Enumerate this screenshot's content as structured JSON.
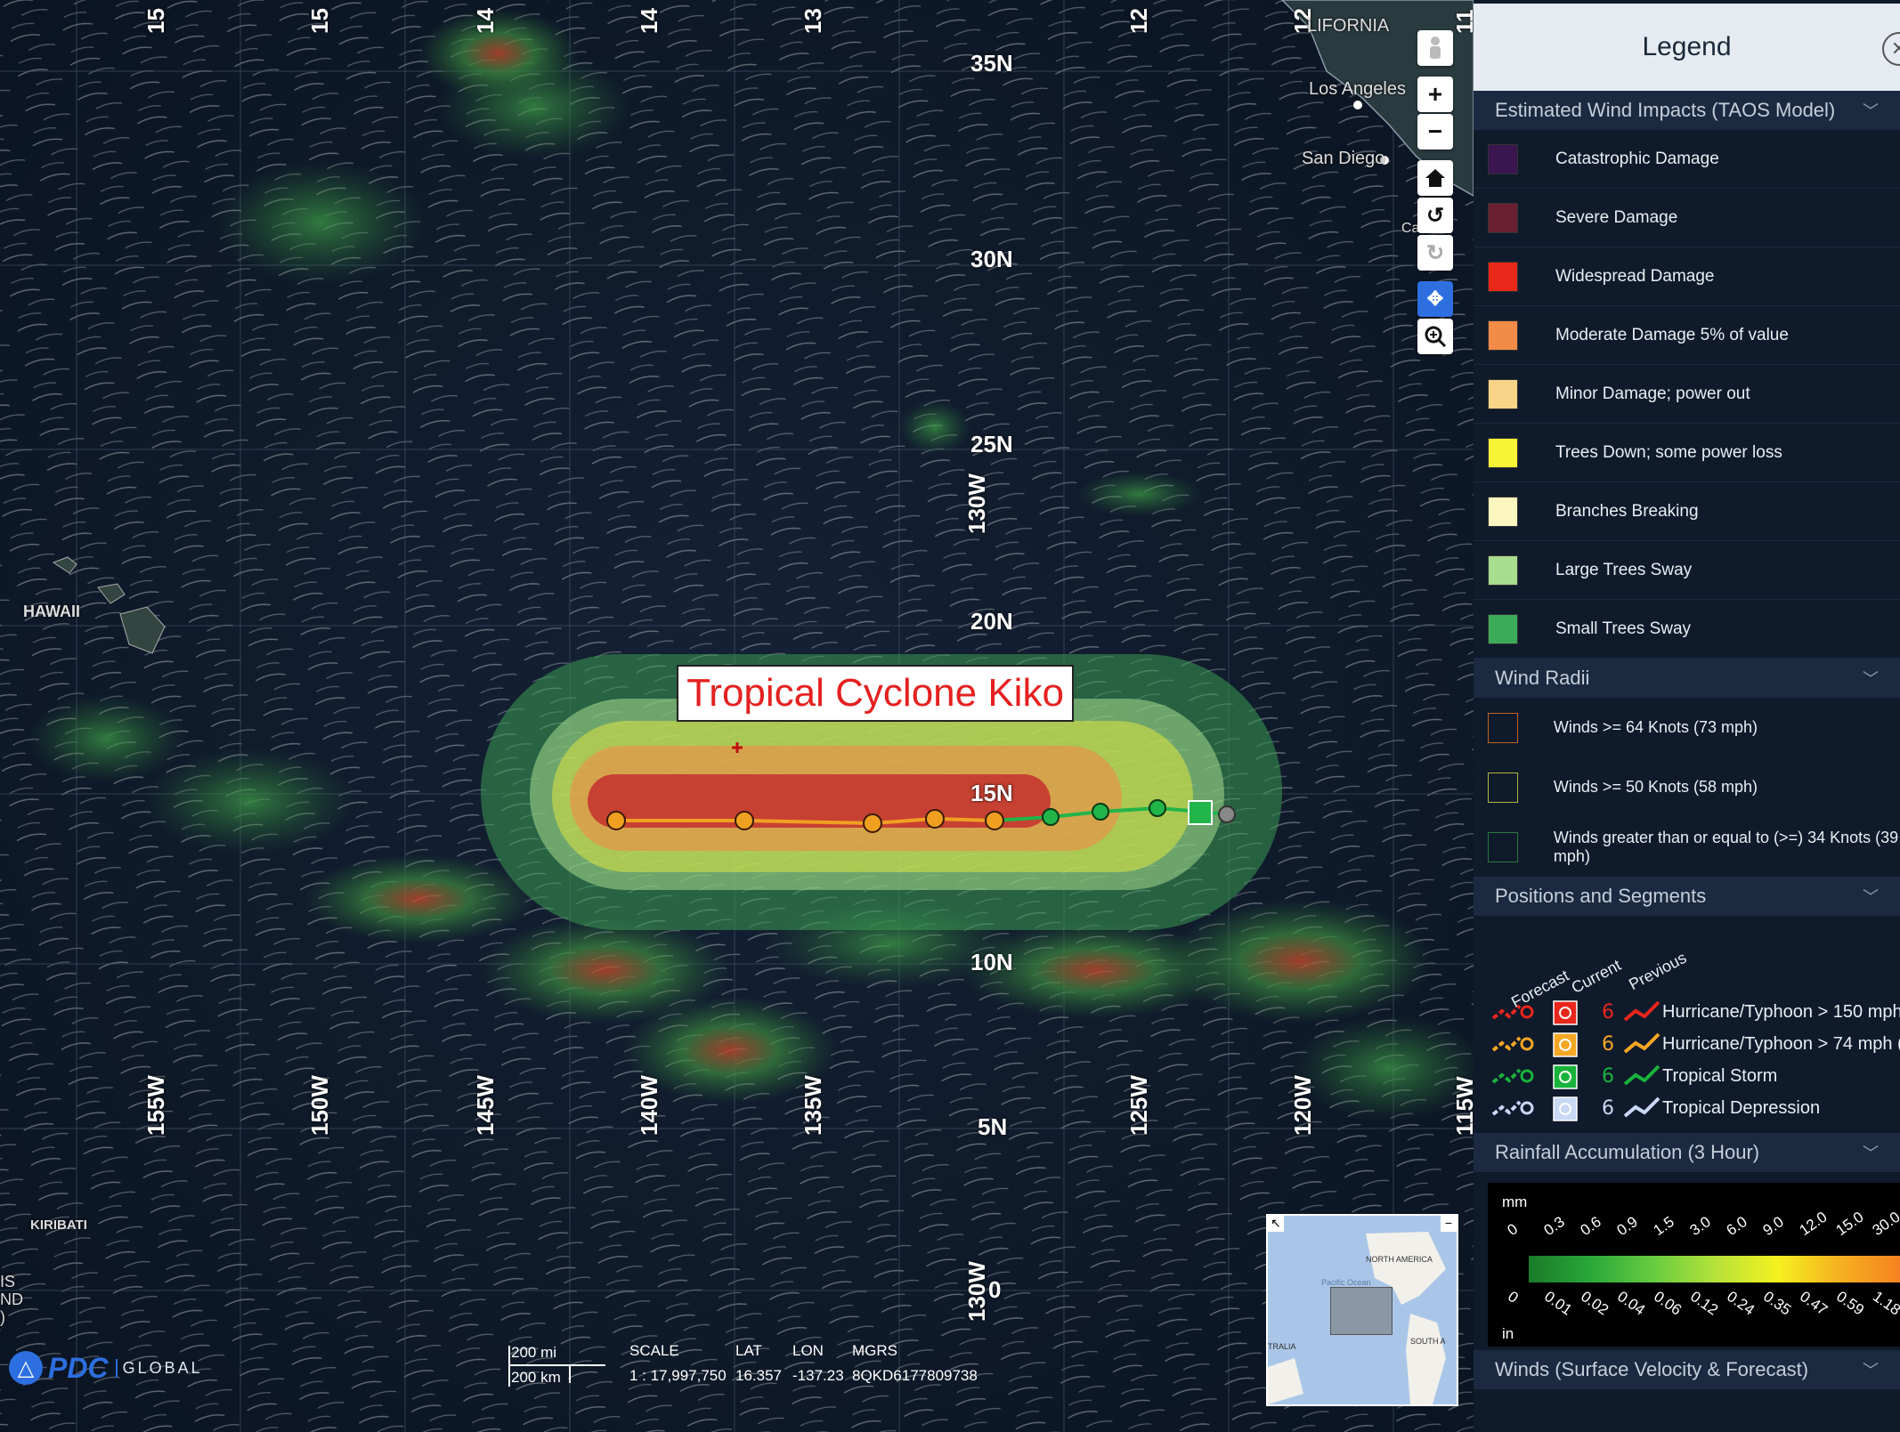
{
  "map": {
    "lat_labels": [
      "35N",
      "30N",
      "25N",
      "20N",
      "15N",
      "10N",
      "5N",
      "0"
    ],
    "lon_labels_top": [
      "15",
      "15",
      "14",
      "14",
      "13",
      "12",
      "12",
      "11"
    ],
    "lon_labels_bottom": [
      "155W",
      "150W",
      "145W",
      "140W",
      "135W",
      "125W",
      "120W",
      "115W"
    ],
    "center_lon_label_1": "130W",
    "center_lon_label_2": "130W",
    "places": {
      "california": "LIFORNIA",
      "los_angeles": "Los Angeles",
      "san_diego": "San Diego",
      "hawaii": "HAWAII",
      "kiribati": "KIRIBATI",
      "baja": "Ca",
      "left_edge": "IS\nND\n)"
    },
    "cyclone_title": "Tropical Cyclone Kiko",
    "track_colors": {
      "hurricane": "#f0a020",
      "storm": "#22b54a"
    },
    "minimap": {
      "north_america": "NORTH AMERICA",
      "south_america": "SOUTH A",
      "australia": "TRALIA",
      "pacific": "Pacific Ocean"
    }
  },
  "status_bar": {
    "scale_mi": "200 mi",
    "scale_km": "200 km",
    "scale_header": "SCALE",
    "scale_value": "1 : 17,997,750",
    "lat_header": "LAT",
    "lat_value": "16.357",
    "lon_header": "LON",
    "lon_value": "-137.23",
    "mgrs_header": "MGRS",
    "mgrs_value": "8QKD6177809738"
  },
  "logo": {
    "pdc": "PDC",
    "global": "GLOBAL"
  },
  "legend": {
    "title": "Legend",
    "sections": {
      "wind_impacts": "Estimated Wind Impacts (TAOS Model)",
      "wind_radii": "Wind Radii",
      "positions": "Positions and Segments",
      "rainfall": "Rainfall Accumulation (3 Hour)",
      "winds": "Winds (Surface Velocity & Forecast)"
    },
    "wind_impacts": [
      {
        "label": "Catastrophic Damage",
        "color": "#3a1550"
      },
      {
        "label": "Severe Damage",
        "color": "#6a2030"
      },
      {
        "label": "Widespread Damage",
        "color": "#e82818"
      },
      {
        "label": "Moderate Damage 5% of value",
        "color": "#f28a48"
      },
      {
        "label": "Minor Damage; power out",
        "color": "#f9d488"
      },
      {
        "label": "Trees Down; some power loss",
        "color": "#f5f535"
      },
      {
        "label": "Branches Breaking",
        "color": "#fbf6c0"
      },
      {
        "label": "Large Trees Sway",
        "color": "#a8dc8e"
      },
      {
        "label": "Small Trees Sway",
        "color": "#3bab5a"
      }
    ],
    "wind_radii": [
      {
        "label": "Winds >= 64 Knots (73 mph)",
        "color": "#c0641c"
      },
      {
        "label": "Winds >= 50 Knots (58 mph)",
        "color": "#b4b440"
      },
      {
        "label": "Winds greater than or equal to (>=) 34 Knots (39 mph)",
        "color": "#2a7a3c"
      }
    ],
    "positions_headers": {
      "forecast": "Forecast",
      "current": "Current",
      "previous": "Previous"
    },
    "positions_rows": [
      {
        "label": "Hurricane/Typhoon > 150 mph",
        "color": "#e8261c"
      },
      {
        "label": "Hurricane/Typhoon > 74 mph (",
        "color": "#f5a623"
      },
      {
        "label": "Tropical Storm",
        "color": "#19b33c"
      },
      {
        "label": "Tropical Depression",
        "color": "#c8d8f5"
      }
    ],
    "rainfall": {
      "unit_mm": "mm",
      "unit_in": "in",
      "mm_ticks": [
        "0",
        "0.3",
        "0.6",
        "0.9",
        "1.5",
        "3.0",
        "6.0",
        "9.0",
        "12.0",
        "15.0",
        "30.0"
      ],
      "in_ticks": [
        "0",
        "0.01",
        "0.02",
        "0.04",
        "0.06",
        "0.12",
        "0.24",
        "0.35",
        "0.47",
        "0.59",
        "1.18"
      ]
    }
  }
}
